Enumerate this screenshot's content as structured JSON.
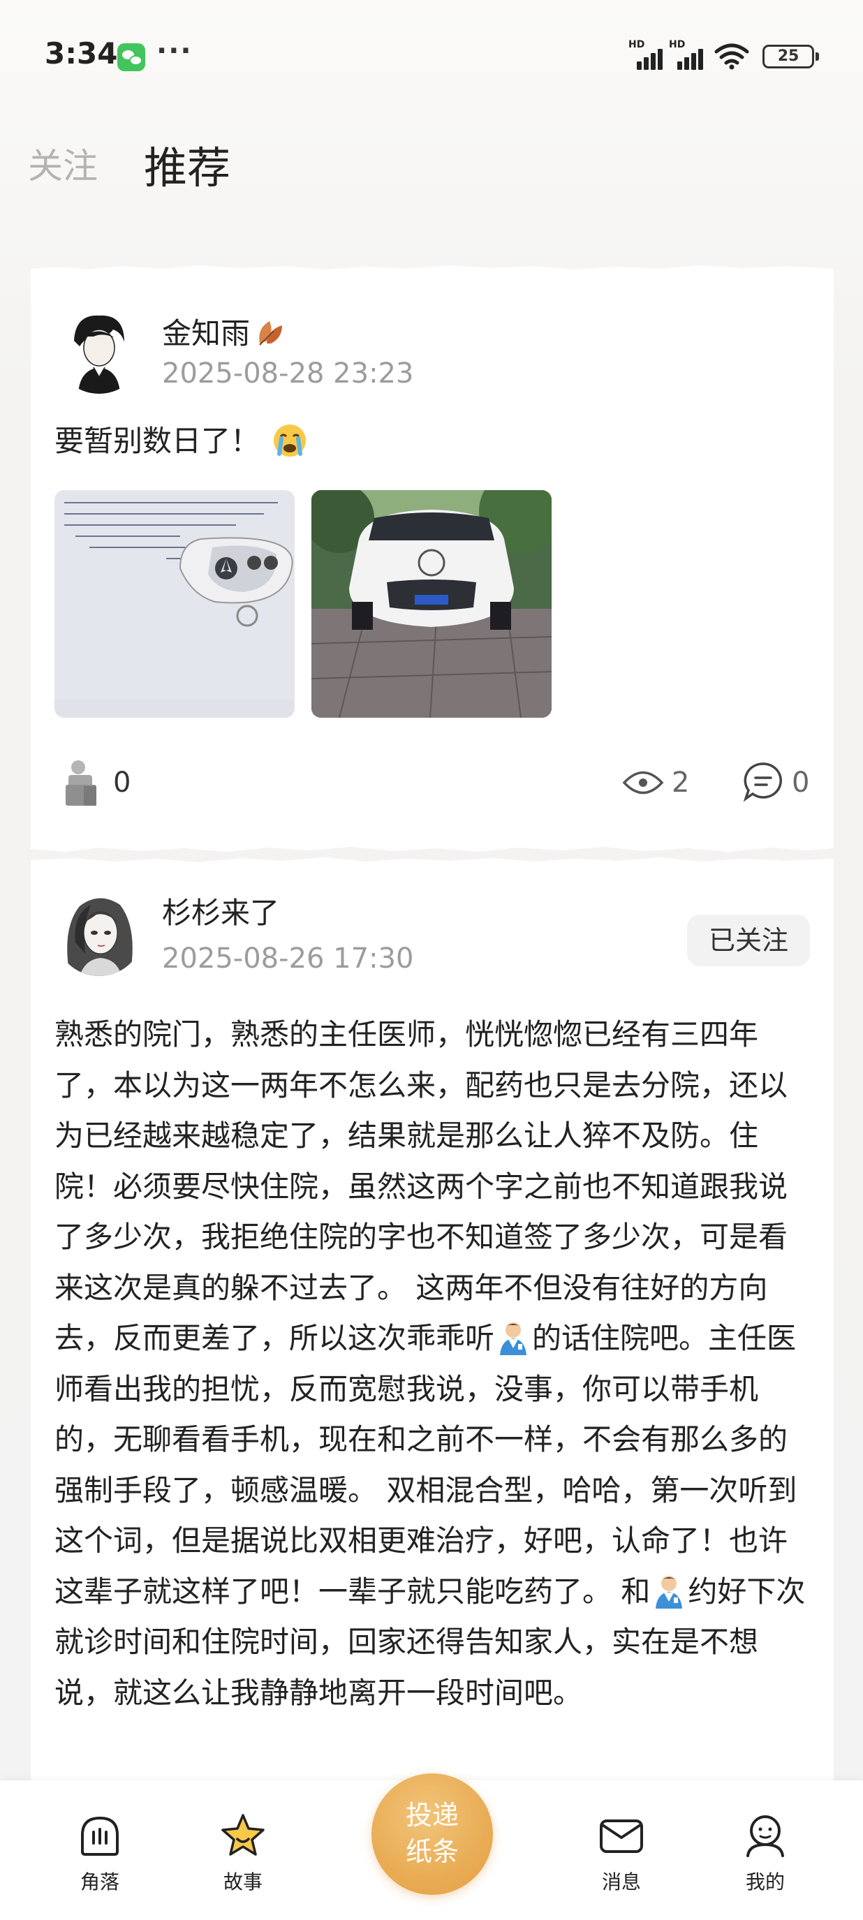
{
  "status_bar": {
    "time": "3:34",
    "more": "···",
    "signal_badge": "HD",
    "battery": "25"
  },
  "tabs": {
    "follow": "关注",
    "recommend": "推荐"
  },
  "posts": [
    {
      "username": "金知雨",
      "timestamp": "2025-08-28 23:23",
      "text": "要暂别数日了！",
      "likes": "0",
      "views": "2",
      "comments": "0"
    },
    {
      "username": "杉杉来了",
      "timestamp": "2025-08-26 17:30",
      "follow_status": "已关注",
      "text_part1": "熟悉的院门，熟悉的主任医师，恍恍惚惚已经有三四年了，本以为这一两年不怎么来，配药也只是去分院，还以为已经越来越稳定了，结果就是那么让人猝不及防。住院！必须要尽快住院，虽然这两个字之前也不知道跟我说了多少次，我拒绝住院的字也不知道签了多少次，可是看来这次是真的躲不过去了。 这两年不但没有往好的方向去，反而更差了，所以这次乖乖听",
      "text_part2": "的话住院吧。主任医师看出我的担忧，反而宽慰我说，没事，你可以带手机的，无聊看看手机，现在和之前不一样，不会有那么多的强制手段了，顿感温暖。 双相混合型，哈哈，第一次听到这个词，但是据说比双相更难治疗，好吧，认命了！也许这辈子就这样了吧！一辈子就只能吃药了。 和",
      "text_part3": "约好下次就诊时间和住院时间，回家还得告知家人，实在是不想说，就这么让我静静地离开一段时间吧。"
    }
  ],
  "bottom_nav": {
    "corner": "角落",
    "story": "故事",
    "post_line1": "投递",
    "post_line2": "纸条",
    "message": "消息",
    "mine": "我的"
  },
  "colors": {
    "accent": "#e9ac55",
    "star": "#e8b040",
    "muted": "#9c9c9c"
  }
}
